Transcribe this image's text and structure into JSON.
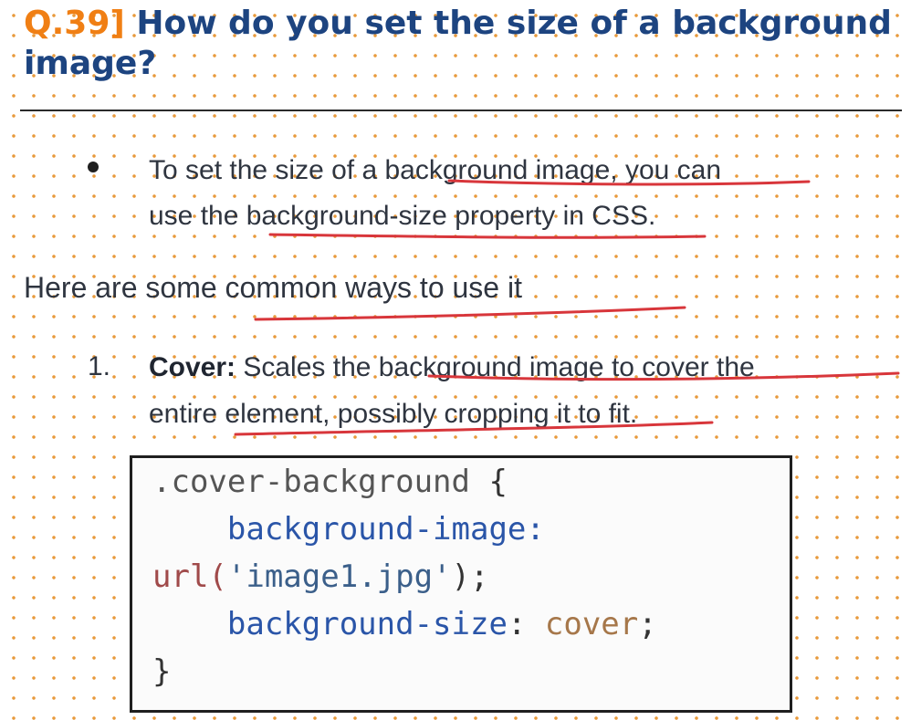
{
  "heading": {
    "number": "Q.39]",
    "title": "How do you set the size of a background image?"
  },
  "bullet": {
    "line1": "To set the size of a background image, you can",
    "line2": "use the background-size property in CSS."
  },
  "intro": "Here are some common ways to use it",
  "item": {
    "number": "1.",
    "term": "Cover:",
    "line1_rest": " Scales the background image to cover the",
    "line2": "entire element, possibly cropping it to fit."
  },
  "code": {
    "line1_selector": ".cover-background",
    "line1_brace": " {",
    "line2_indent": "    ",
    "line2_prop": "background-image",
    "line2_colon": ":",
    "line3_fn": "url(",
    "line3_str": "'image1.jpg'",
    "line3_end": ");",
    "line4_indent": "    ",
    "line4_prop": "background-size",
    "line4_colon": ": ",
    "line4_val": "cover",
    "line4_end": ";",
    "line5": "}"
  },
  "colors": {
    "heading_number": "#f07f14",
    "heading_title": "#1d4480",
    "dot_grid": "#e89a3c",
    "underline": "#d8363b"
  }
}
